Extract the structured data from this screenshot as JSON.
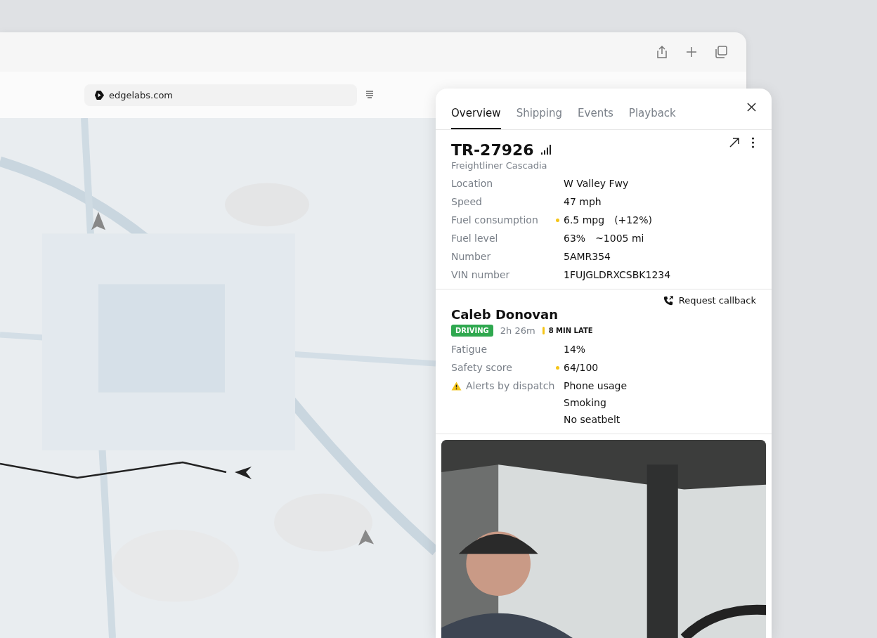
{
  "browser": {
    "address": "edgelabs.com"
  },
  "panel": {
    "tabs": [
      {
        "label": "Overview",
        "selected": true
      },
      {
        "label": "Shipping",
        "selected": false
      },
      {
        "label": "Events",
        "selected": false
      },
      {
        "label": "Playback",
        "selected": false
      }
    ],
    "vehicle": {
      "id": "TR-27926",
      "model": "Freightliner Cascadia",
      "fields": [
        {
          "label": "Location",
          "values": [
            "W Valley Fwy"
          ],
          "dot": false
        },
        {
          "label": "Speed",
          "values": [
            "47 mph"
          ],
          "dot": false
        },
        {
          "label": "Fuel consumption",
          "values": [
            "6.5 mpg",
            "(+12%)"
          ],
          "dot": true
        },
        {
          "label": "Fuel level",
          "values": [
            "63%",
            "~1005 mi"
          ],
          "dot": false
        },
        {
          "label": "Number",
          "values": [
            "5AMR354"
          ],
          "dot": false
        },
        {
          "label": "VIN number",
          "values": [
            "1FUJGLDRXCSBK1234"
          ],
          "dot": false
        }
      ]
    },
    "driver": {
      "callback": "Request callback",
      "name": "Caleb Donovan",
      "status": "DRIVING",
      "duration": "2h 26m",
      "delay": "8 MIN LATE",
      "fields": [
        {
          "label": "Fatigue",
          "values": [
            "14%"
          ],
          "dot": false,
          "warning": false
        },
        {
          "label": "Safety score",
          "values": [
            "64/100"
          ],
          "dot": true,
          "warning": false
        },
        {
          "label": "Alerts by dispatch",
          "values": [
            "Phone usage",
            "Smoking",
            "No seatbelt"
          ],
          "dot": false,
          "warning": true
        }
      ]
    }
  }
}
